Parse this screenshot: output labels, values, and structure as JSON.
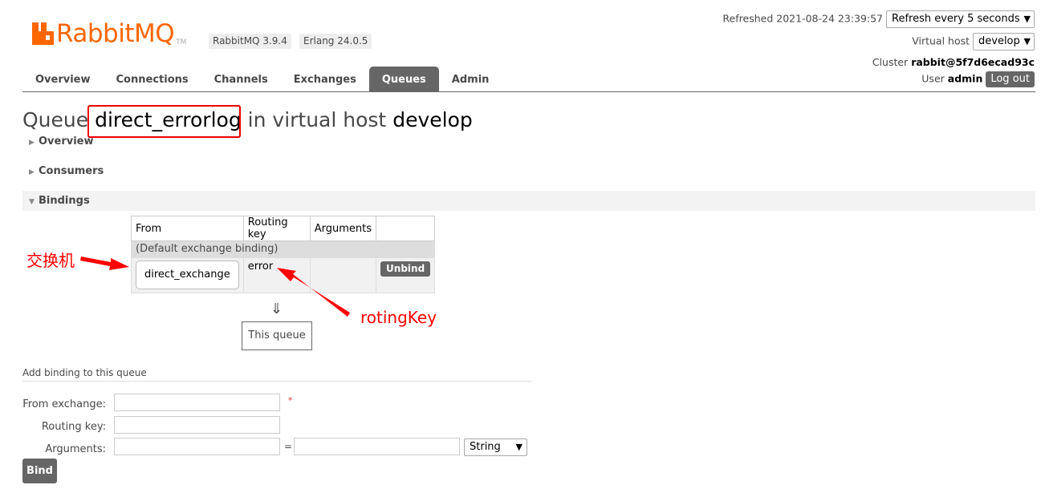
{
  "header": {
    "logo_text": "RabbitMQ",
    "logo_tm": "TM",
    "version": "RabbitMQ 3.9.4",
    "erlang": "Erlang 24.0.5",
    "refreshed_label": "Refreshed",
    "refreshed_time": "2021-08-24 23:39:57",
    "refresh_option": "Refresh every 5 seconds",
    "vhost_label": "Virtual host",
    "vhost_value": "develop",
    "cluster_label": "Cluster",
    "cluster_value": "rabbit@5f7d6ecad93c",
    "user_label": "User",
    "user_value": "admin",
    "logout_label": "Log out"
  },
  "tabs": [
    {
      "label": "Overview",
      "active": false
    },
    {
      "label": "Connections",
      "active": false
    },
    {
      "label": "Channels",
      "active": false
    },
    {
      "label": "Exchanges",
      "active": false
    },
    {
      "label": "Queues",
      "active": true
    },
    {
      "label": "Admin",
      "active": false
    }
  ],
  "title": {
    "prefix": "Queue",
    "queue_name": "direct_errorlog",
    "middle": "in virtual host",
    "vhost": "develop"
  },
  "sections": {
    "overview": "Overview",
    "consumers": "Consumers",
    "bindings": "Bindings"
  },
  "bindings_table": {
    "headers": [
      "From",
      "Routing key",
      "Arguments",
      ""
    ],
    "default_row": "(Default exchange binding)",
    "rows": [
      {
        "from": "direct_exchange",
        "routing_key": "error",
        "arguments": "",
        "action": "Unbind"
      }
    ],
    "arrow": "⇓",
    "this_queue": "This queue"
  },
  "annotations": {
    "exchange_label": "交换机",
    "routing_label": "rotingKey"
  },
  "add_binding": {
    "title": "Add binding to this queue",
    "from_exchange_label": "From exchange:",
    "routing_key_label": "Routing key:",
    "arguments_label": "Arguments:",
    "required_mark": "*",
    "equals": "=",
    "type_value": "String",
    "bind_label": "Bind"
  },
  "colors": {
    "brand": "#ff6600",
    "active_tab": "#666666",
    "annotation": "#ff0000"
  }
}
